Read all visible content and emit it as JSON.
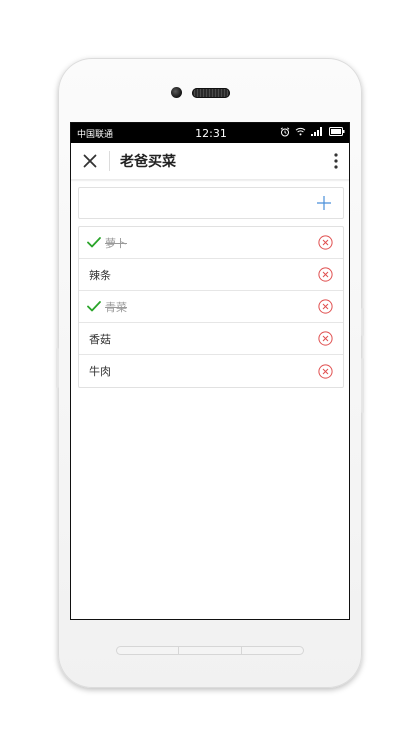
{
  "status_bar": {
    "carrier": "中国联通",
    "time": "12:31",
    "icons": [
      "alarm-icon",
      "wifi-icon",
      "signal-icon",
      "battery-icon"
    ]
  },
  "app_bar": {
    "title": "老爸买菜",
    "close_icon": "close-icon",
    "menu_icon": "more-vertical-icon"
  },
  "add_item": {
    "value": "",
    "placeholder": "",
    "add_icon": "plus-icon"
  },
  "items": [
    {
      "label": "萝卜",
      "done": true
    },
    {
      "label": "辣条",
      "done": false
    },
    {
      "label": "青菜",
      "done": true
    },
    {
      "label": "香菇",
      "done": false
    },
    {
      "label": "牛肉",
      "done": false
    }
  ],
  "colors": {
    "check": "#2aa52a",
    "delete": "#e05050",
    "add": "#4a8fd9",
    "statusbar": "#000000"
  }
}
